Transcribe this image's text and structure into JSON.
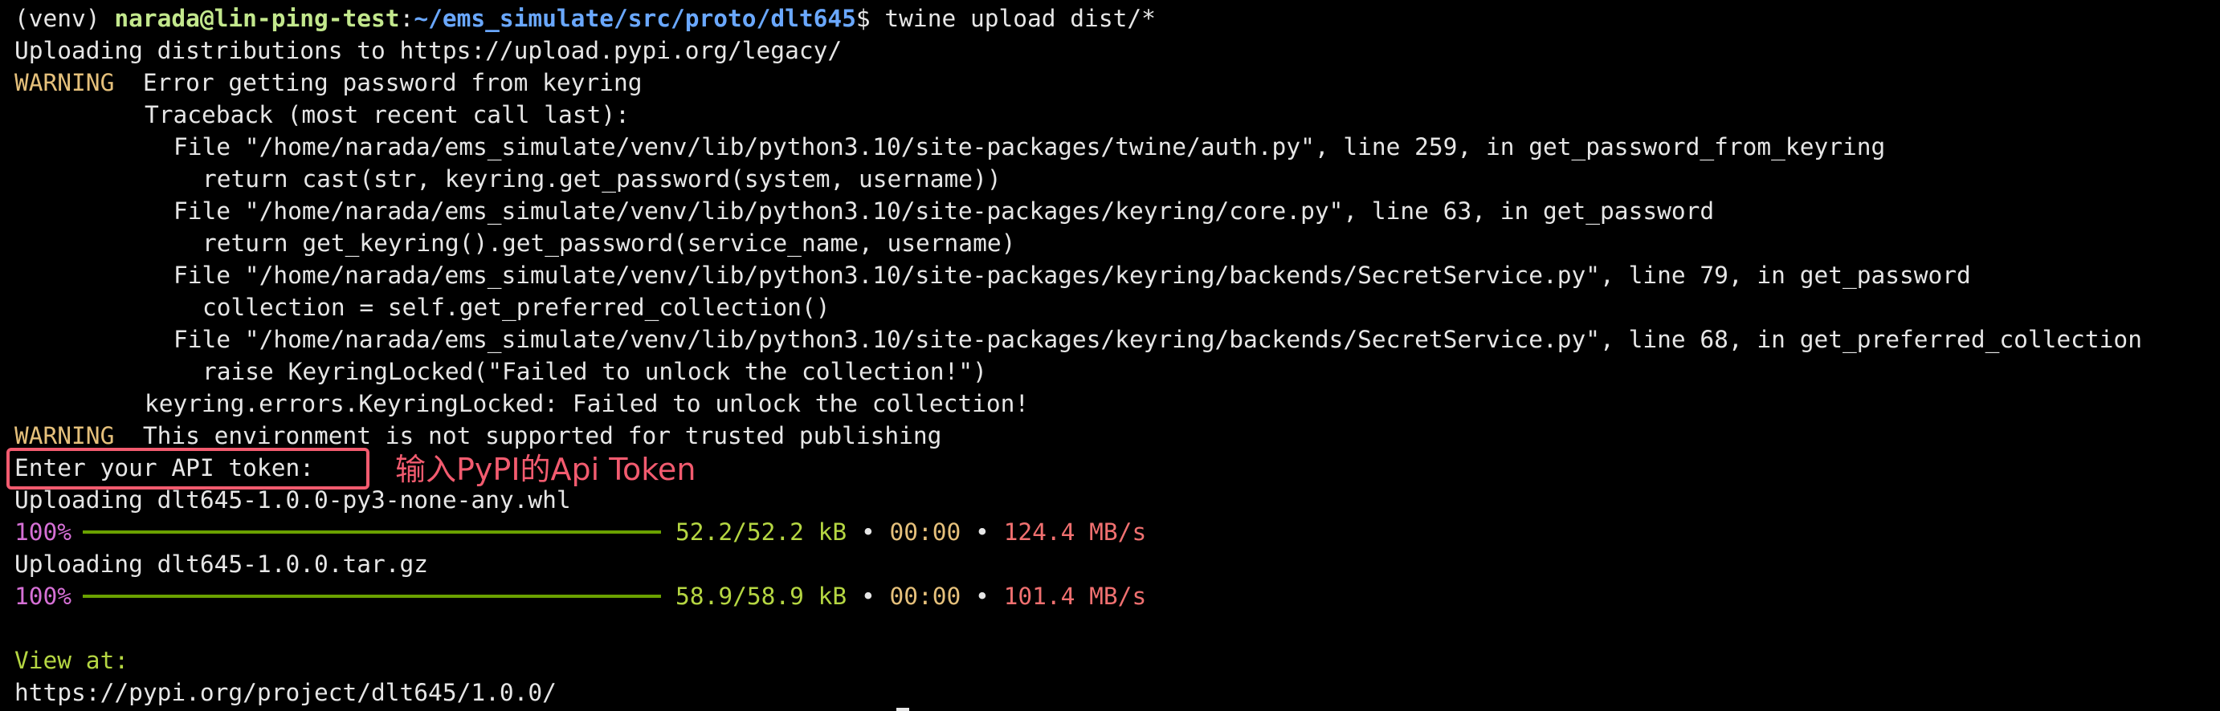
{
  "prompt": {
    "venv": "(venv) ",
    "user_host": "narada@lin-ping-test",
    "colon": ":",
    "path": "~/ems_simulate/src/proto/dlt645",
    "dollar_command": "$ twine upload dist/*"
  },
  "output": {
    "uploading_to": "Uploading distributions to https://upload.pypi.org/legacy/",
    "warning_label": "WARNING",
    "warning1_message": "  Error getting password from keyring",
    "traceback_header": "Traceback (most recent call last):",
    "traceback_lines": [
      "File \"/home/narada/ems_simulate/venv/lib/python3.10/site-packages/twine/auth.py\", line 259, in get_password_from_keyring",
      "return cast(str, keyring.get_password(system, username))",
      "File \"/home/narada/ems_simulate/venv/lib/python3.10/site-packages/keyring/core.py\", line 63, in get_password",
      "return get_keyring().get_password(service_name, username)",
      "File \"/home/narada/ems_simulate/venv/lib/python3.10/site-packages/keyring/backends/SecretService.py\", line 79, in get_password",
      "collection = self.get_preferred_collection()",
      "File \"/home/narada/ems_simulate/venv/lib/python3.10/site-packages/keyring/backends/SecretService.py\", line 68, in get_preferred_collection",
      "raise KeyringLocked(\"Failed to unlock the collection!\")"
    ],
    "keyring_error": "keyring.errors.KeyringLocked: Failed to unlock the collection!",
    "warning2_message": "  This environment is not supported for trusted publishing",
    "api_token_prompt": "Enter your API token:",
    "annotation": "输入PyPI的Api Token",
    "upload1_label": "Uploading dlt645-1.0.0-py3-none-any.whl",
    "upload1": {
      "percent": "100%",
      "progress_fraction": 1.0,
      "sizes": "52.2/52.2 kB",
      "bullet1": " • ",
      "eta": "00:00",
      "bullet2": " • ",
      "rate": "124.4 MB/s"
    },
    "upload2_label": "Uploading dlt645-1.0.0.tar.gz",
    "upload2": {
      "percent": "100%",
      "progress_fraction": 1.0,
      "sizes": "58.9/58.9 kB",
      "bullet1": " • ",
      "eta": "00:00",
      "bullet2": " • ",
      "rate": "101.4 MB/s"
    },
    "view_at_label": "View at:",
    "project_url": "https://pypi.org/project/dlt645/1.0.0/"
  },
  "colors": {
    "background": "#000000",
    "text": "#e6e6e6",
    "prompt_user": "#c3e88d",
    "prompt_path": "#6aa8ff",
    "warning": "#e5c07b",
    "percent": "#d670d6",
    "progress_bar": "#6aa100",
    "sizes": "#b5d642",
    "rate": "#f07070",
    "annotation": "#f25b6f"
  }
}
